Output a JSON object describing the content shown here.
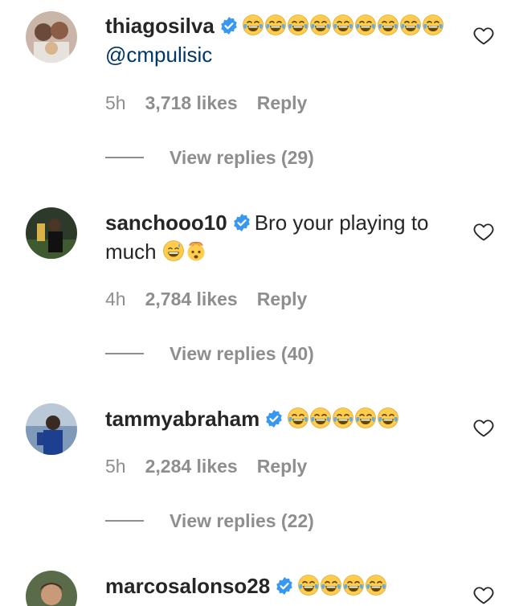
{
  "comments": [
    {
      "username": "thiagosilva",
      "emoji_count": 9,
      "mention": "@cmpulisic",
      "text": "",
      "time": "5h",
      "likes": "3,718 likes",
      "reply_label": "Reply",
      "view_replies": "View replies (29)"
    },
    {
      "username": "sanchooo10",
      "text": "Bro your playing to much",
      "time": "4h",
      "likes": "2,784 likes",
      "reply_label": "Reply",
      "view_replies": "View replies (40)"
    },
    {
      "username": "tammyabraham",
      "emoji_count": 5,
      "time": "5h",
      "likes": "2,284 likes",
      "reply_label": "Reply",
      "view_replies": "View replies (22)"
    },
    {
      "username": "marcosalonso28",
      "emoji_count": 4
    }
  ],
  "icons": {
    "verified": "verified-badge-icon",
    "like": "heart-outline-icon",
    "emoji_laugh": "face-with-tears-of-joy",
    "emoji_sweat": "grinning-face-with-sweat",
    "emoji_exploding": "exploding-head"
  },
  "colors": {
    "username": "#262626",
    "meta": "#8e8e8e",
    "mention": "#00376b",
    "verified": "#3897f0"
  }
}
